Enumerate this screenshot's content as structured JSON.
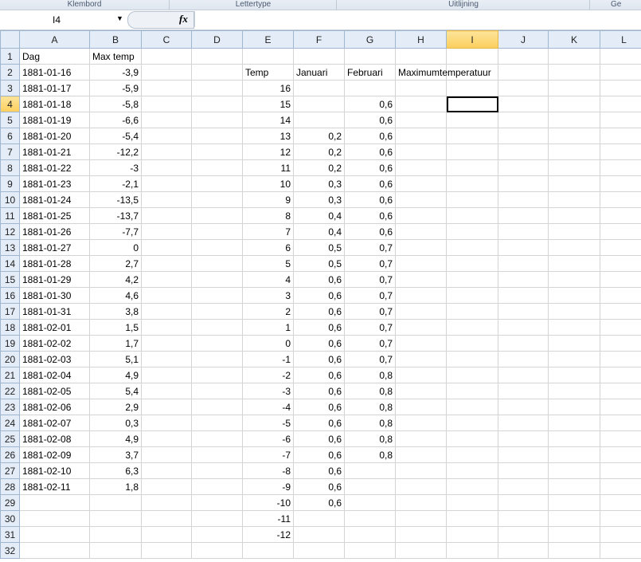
{
  "ribbon": {
    "groups": [
      "Klembord",
      "Lettertype",
      "Uitlijning",
      "Ge"
    ]
  },
  "formula_bar": {
    "name_box": "I4",
    "fx_label": "fx",
    "formula": ""
  },
  "sheet": {
    "columns": [
      "A",
      "B",
      "C",
      "D",
      "E",
      "F",
      "G",
      "H",
      "I",
      "J",
      "K",
      "L"
    ],
    "active_cell": "I4",
    "rows": [
      [
        "Dag",
        "Max temp",
        "",
        "",
        "",
        "",
        "",
        "",
        "",
        "",
        "",
        ""
      ],
      [
        "1881-01-16",
        "-3,9",
        "",
        "",
        "Temp",
        "Januari",
        "Februari",
        "Maximumtemperatuur",
        "",
        "",
        "",
        ""
      ],
      [
        "1881-01-17",
        "-5,9",
        "",
        "",
        "16",
        "",
        "",
        "",
        "",
        "",
        "",
        ""
      ],
      [
        "1881-01-18",
        "-5,8",
        "",
        "",
        "15",
        "",
        "0,6",
        "",
        "",
        "",
        "",
        ""
      ],
      [
        "1881-01-19",
        "-6,6",
        "",
        "",
        "14",
        "",
        "0,6",
        "",
        "",
        "",
        "",
        ""
      ],
      [
        "1881-01-20",
        "-5,4",
        "",
        "",
        "13",
        "0,2",
        "0,6",
        "",
        "",
        "",
        "",
        ""
      ],
      [
        "1881-01-21",
        "-12,2",
        "",
        "",
        "12",
        "0,2",
        "0,6",
        "",
        "",
        "",
        "",
        ""
      ],
      [
        "1881-01-22",
        "-3",
        "",
        "",
        "11",
        "0,2",
        "0,6",
        "",
        "",
        "",
        "",
        ""
      ],
      [
        "1881-01-23",
        "-2,1",
        "",
        "",
        "10",
        "0,3",
        "0,6",
        "",
        "",
        "",
        "",
        ""
      ],
      [
        "1881-01-24",
        "-13,5",
        "",
        "",
        "9",
        "0,3",
        "0,6",
        "",
        "",
        "",
        "",
        ""
      ],
      [
        "1881-01-25",
        "-13,7",
        "",
        "",
        "8",
        "0,4",
        "0,6",
        "",
        "",
        "",
        "",
        ""
      ],
      [
        "1881-01-26",
        "-7,7",
        "",
        "",
        "7",
        "0,4",
        "0,6",
        "",
        "",
        "",
        "",
        ""
      ],
      [
        "1881-01-27",
        "0",
        "",
        "",
        "6",
        "0,5",
        "0,7",
        "",
        "",
        "",
        "",
        ""
      ],
      [
        "1881-01-28",
        "2,7",
        "",
        "",
        "5",
        "0,5",
        "0,7",
        "",
        "",
        "",
        "",
        ""
      ],
      [
        "1881-01-29",
        "4,2",
        "",
        "",
        "4",
        "0,6",
        "0,7",
        "",
        "",
        "",
        "",
        ""
      ],
      [
        "1881-01-30",
        "4,6",
        "",
        "",
        "3",
        "0,6",
        "0,7",
        "",
        "",
        "",
        "",
        ""
      ],
      [
        "1881-01-31",
        "3,8",
        "",
        "",
        "2",
        "0,6",
        "0,7",
        "",
        "",
        "",
        "",
        ""
      ],
      [
        "1881-02-01",
        "1,5",
        "",
        "",
        "1",
        "0,6",
        "0,7",
        "",
        "",
        "",
        "",
        ""
      ],
      [
        "1881-02-02",
        "1,7",
        "",
        "",
        "0",
        "0,6",
        "0,7",
        "",
        "",
        "",
        "",
        ""
      ],
      [
        "1881-02-03",
        "5,1",
        "",
        "",
        "-1",
        "0,6",
        "0,7",
        "",
        "",
        "",
        "",
        ""
      ],
      [
        "1881-02-04",
        "4,9",
        "",
        "",
        "-2",
        "0,6",
        "0,8",
        "",
        "",
        "",
        "",
        ""
      ],
      [
        "1881-02-05",
        "5,4",
        "",
        "",
        "-3",
        "0,6",
        "0,8",
        "",
        "",
        "",
        "",
        ""
      ],
      [
        "1881-02-06",
        "2,9",
        "",
        "",
        "-4",
        "0,6",
        "0,8",
        "",
        "",
        "",
        "",
        ""
      ],
      [
        "1881-02-07",
        "0,3",
        "",
        "",
        "-5",
        "0,6",
        "0,8",
        "",
        "",
        "",
        "",
        ""
      ],
      [
        "1881-02-08",
        "4,9",
        "",
        "",
        "-6",
        "0,6",
        "0,8",
        "",
        "",
        "",
        "",
        ""
      ],
      [
        "1881-02-09",
        "3,7",
        "",
        "",
        "-7",
        "0,6",
        "0,8",
        "",
        "",
        "",
        "",
        ""
      ],
      [
        "1881-02-10",
        "6,3",
        "",
        "",
        "-8",
        "0,6",
        "",
        "",
        "",
        "",
        "",
        ""
      ],
      [
        "1881-02-11",
        "1,8",
        "",
        "",
        "-9",
        "0,6",
        "",
        "",
        "",
        "",
        "",
        ""
      ],
      [
        "",
        "",
        "",
        "",
        "-10",
        "0,6",
        "",
        "",
        "",
        "",
        "",
        ""
      ],
      [
        "",
        "",
        "",
        "",
        "-11",
        "",
        "",
        "",
        "",
        "",
        "",
        ""
      ],
      [
        "",
        "",
        "",
        "",
        "-12",
        "",
        "",
        "",
        "",
        "",
        "",
        ""
      ],
      [
        "",
        "",
        "",
        "",
        "",
        "",
        "",
        "",
        "",
        "",
        "",
        ""
      ]
    ]
  }
}
